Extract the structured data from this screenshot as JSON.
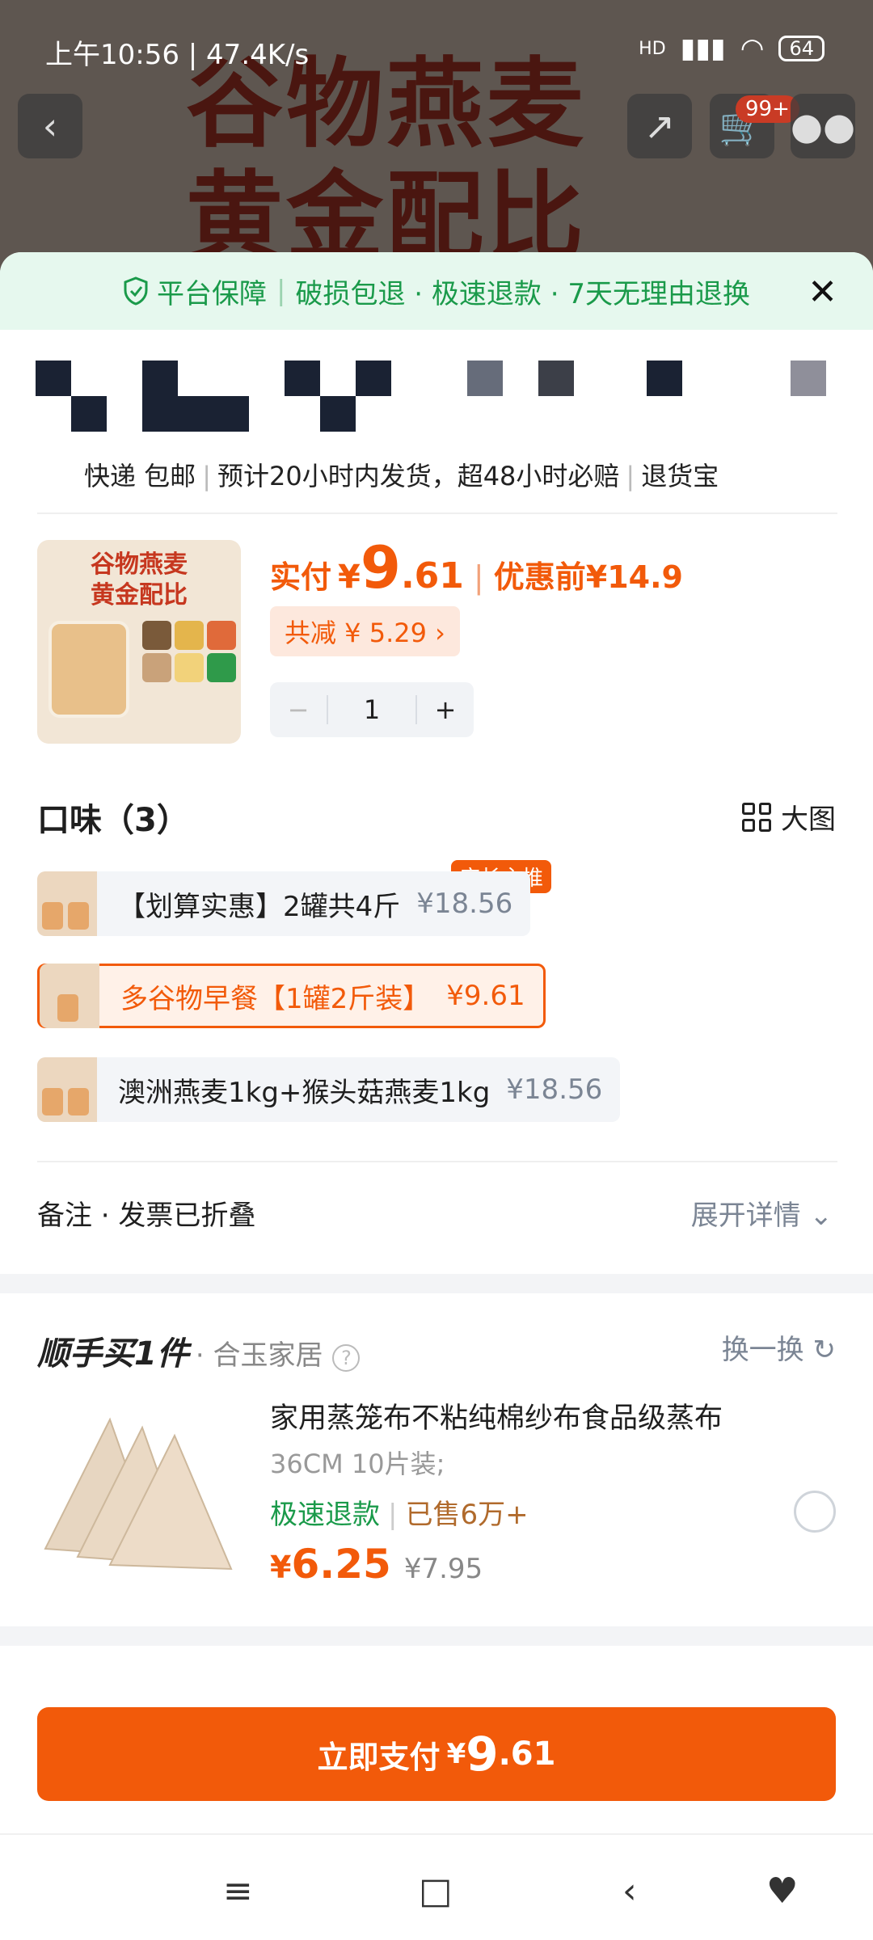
{
  "status_bar": {
    "time": "上午10:56 | 47.4K/s",
    "signal": "HD",
    "battery": "64"
  },
  "hero": {
    "line1": "谷物燕麦",
    "line2": "黄金配比",
    "cart_badge": "99+"
  },
  "guarantee": {
    "label": "平台保障",
    "items": "破损包退 · 极速退款 · 7天无理由退换"
  },
  "delivery": {
    "shipping": "快递 包邮",
    "estimate": "预计20小时内发货，超48小时必赔",
    "return": "退货宝"
  },
  "product": {
    "image_text_1": "谷物燕麦",
    "image_text_2": "黄金配比",
    "pay_label": "实付",
    "yen": "¥",
    "price_big": "9",
    "price_small": ".61",
    "before_label": "优惠前",
    "before_price": "¥14.9",
    "discount": "共减 ¥ 5.29 ›",
    "qty_minus": "−",
    "quantity": "1",
    "qty_plus": "+"
  },
  "flavor": {
    "title": "口味（3）",
    "big_image_label": "大图",
    "recommend_tag": "店长主推",
    "options": [
      {
        "name": "【划算实惠】2罐共4斤",
        "price": "¥18.56",
        "selected": false
      },
      {
        "name": "多谷物早餐【1罐2斤装】",
        "price": "¥9.61",
        "selected": true
      },
      {
        "name": "澳洲燕麦1kg+猴头菇燕麦1kg",
        "price": "¥18.56",
        "selected": false
      }
    ]
  },
  "notes": {
    "label": "备注 · 发票已折叠",
    "expand": "展开详情"
  },
  "addon": {
    "heading": "顺手买1件",
    "store": "· 合玉家居",
    "swap": "换一换",
    "title": "家用蒸笼布不粘纯棉纱布食品级蒸布",
    "spec": "36CM 10片装;",
    "tag_fast": "极速退款",
    "tag_sold": "已售6万+",
    "yen": "¥",
    "price": "6.25",
    "old_price": "¥7.95"
  },
  "pay_button": {
    "label": "立即支付",
    "yen": "¥",
    "big": "9",
    "small": ".61"
  },
  "colors": {
    "accent": "#f25a0a",
    "guarantee_green": "#1a9a4a",
    "sheet_bg": "#ffffff"
  }
}
